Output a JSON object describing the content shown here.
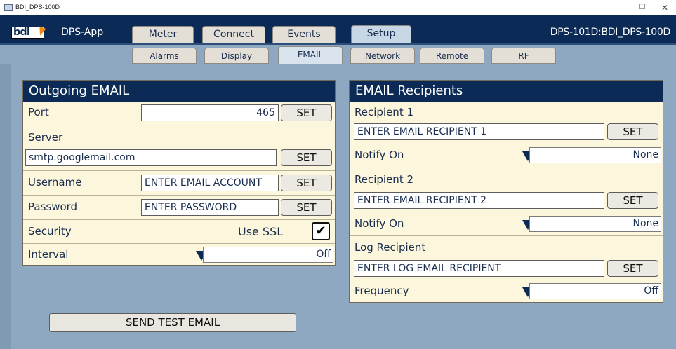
{
  "window": {
    "title": "BDI_DPS-100D",
    "minimize": "—",
    "maximize": "☐",
    "close": "✕"
  },
  "header": {
    "logo_text": "bdi",
    "app_name": "DPS-App",
    "device": "DPS-101D:BDI_DPS-100D",
    "tabs": [
      {
        "label": "Meter",
        "active": false
      },
      {
        "label": "Connect",
        "active": false
      },
      {
        "label": "Events",
        "active": false
      },
      {
        "label": "Setup",
        "active": true
      }
    ]
  },
  "subtabs": [
    {
      "label": "Alarms",
      "active": false
    },
    {
      "label": "Display",
      "active": false
    },
    {
      "label": "EMAIL",
      "active": true
    },
    {
      "label": "Network",
      "active": false
    },
    {
      "label": "Remote",
      "active": false
    },
    {
      "label": "RF",
      "active": false
    }
  ],
  "outgoing": {
    "title": "Outgoing EMAIL",
    "port_label": "Port",
    "port_value": "465",
    "server_label": "Server",
    "server_value": "smtp.googlemail.com",
    "username_label": "Username",
    "username_value": "ENTER EMAIL ACCOUNT",
    "password_label": "Password",
    "password_value": "ENTER PASSWORD",
    "security_label": "Security",
    "ssl_label": "Use SSL",
    "ssl_checked": true,
    "interval_label": "Interval",
    "interval_value": "Off",
    "set_label": "SET"
  },
  "recipients": {
    "title": "EMAIL Recipients",
    "r1_label": "Recipient 1",
    "r1_value": "ENTER EMAIL RECIPIENT 1",
    "notify_label": "Notify On",
    "notify1_value": "None",
    "r2_label": "Recipient 2",
    "r2_value": "ENTER EMAIL RECIPIENT 2",
    "notify2_value": "None",
    "log_label": "Log Recipient",
    "log_value": "ENTER LOG EMAIL RECIPIENT",
    "frequency_label": "Frequency",
    "frequency_value": "Off",
    "set_label": "SET"
  },
  "actions": {
    "send_test": "SEND TEST EMAIL"
  },
  "colors": {
    "header": "#0b2b56",
    "panel": "#fcf7dc",
    "background": "#8da8c0",
    "logo_accent": "#f28a14"
  }
}
